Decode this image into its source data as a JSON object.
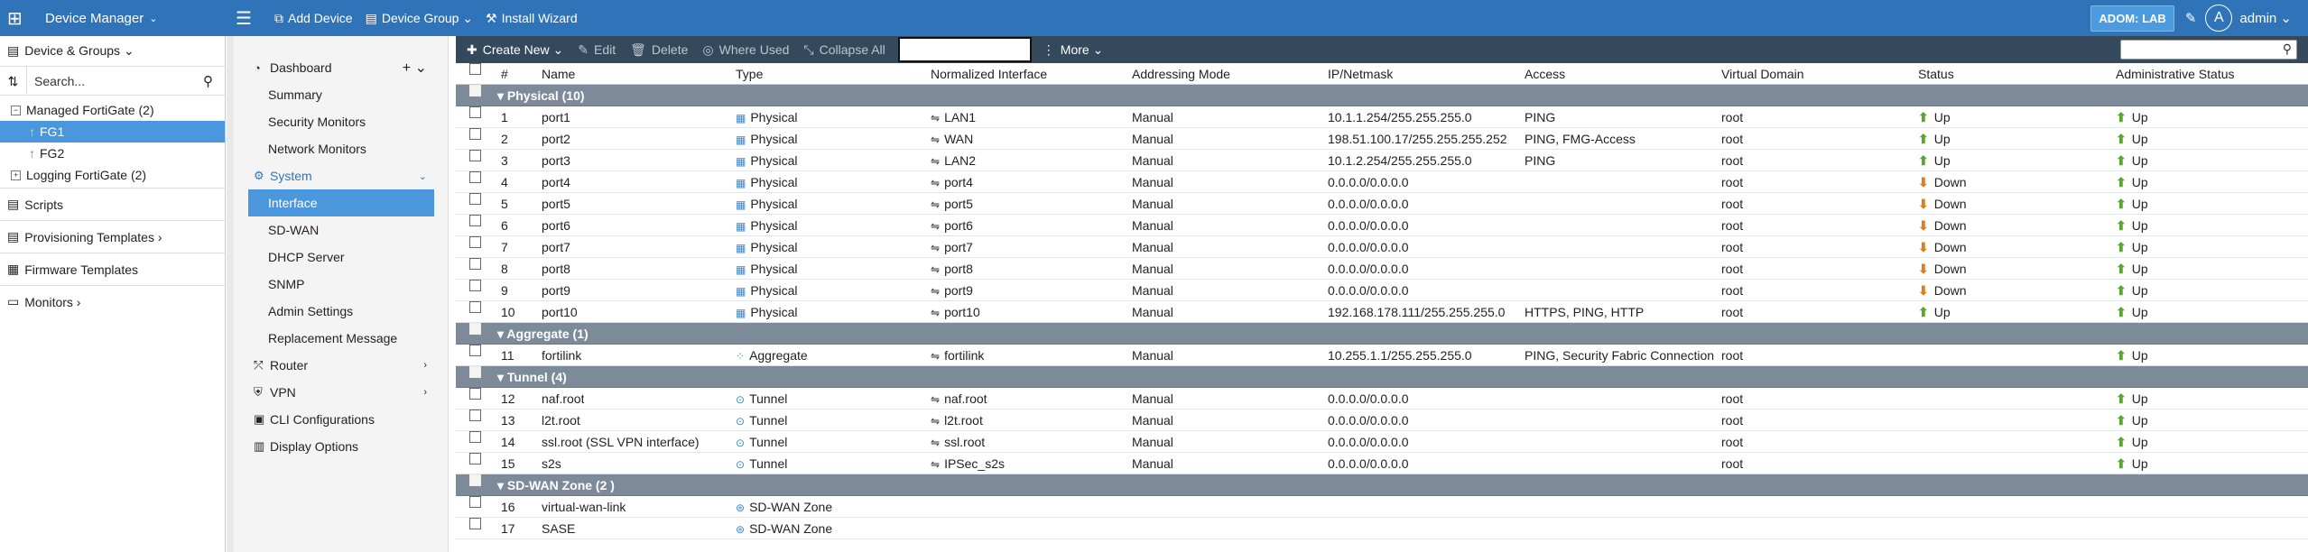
{
  "app": {
    "title": "Device Manager",
    "adom": "ADOM: LAB",
    "user_initial": "A",
    "user": "admin"
  },
  "topbar": {
    "actions": [
      {
        "icon": "add-device-icon",
        "glyph": "⧉",
        "label": "Add Device"
      },
      {
        "icon": "device-group-icon",
        "glyph": "▤",
        "label": "Device Group ⌄"
      },
      {
        "icon": "install-wizard-icon",
        "glyph": "⚒",
        "label": "Install Wizard"
      }
    ]
  },
  "left": {
    "header": "Device & Groups ⌄",
    "search_placeholder": "Search...",
    "tree": [
      {
        "name": "tree-managed",
        "label": "Managed FortiGate (2)",
        "box": "−",
        "type": "group",
        "selected": false
      },
      {
        "name": "tree-fg1",
        "label": "FG1",
        "type": "device",
        "selected": true
      },
      {
        "name": "tree-fg2",
        "label": "FG2",
        "type": "device",
        "selected": false
      },
      {
        "name": "tree-logging",
        "label": "Logging FortiGate (2)",
        "box": "+",
        "type": "group",
        "selected": false
      }
    ],
    "menu": [
      {
        "name": "menu-scripts",
        "icon": "script-icon",
        "glyph": "▤",
        "label": "Scripts"
      },
      {
        "name": "menu-provisioning",
        "icon": "templates-icon",
        "glyph": "▤",
        "label": "Provisioning Templates ›"
      },
      {
        "name": "menu-firmware",
        "icon": "firmware-icon",
        "glyph": "▦",
        "label": "Firmware Templates"
      },
      {
        "name": "menu-monitors",
        "icon": "monitor-icon",
        "glyph": "▭",
        "label": "Monitors ›"
      }
    ]
  },
  "nav": [
    {
      "label": "Dashboard",
      "top": true,
      "glyph": "◔",
      "icon": "dashboard-icon",
      "plus": "+ ⌄"
    },
    {
      "label": "Summary"
    },
    {
      "label": "Security Monitors"
    },
    {
      "label": "Network Monitors"
    },
    {
      "label": "System",
      "top": true,
      "glyph": "⚙",
      "icon": "system-icon",
      "system": true,
      "arrow": "⌄"
    },
    {
      "label": "Interface",
      "selected": true
    },
    {
      "label": "SD-WAN"
    },
    {
      "label": "DHCP Server"
    },
    {
      "label": "SNMP"
    },
    {
      "label": "Admin Settings"
    },
    {
      "label": "Replacement Message"
    },
    {
      "label": "Router",
      "top": true,
      "glyph": "⤱",
      "icon": "router-icon",
      "arrow": "›"
    },
    {
      "label": "VPN",
      "top": true,
      "glyph": "⛨",
      "icon": "vpn-icon",
      "arrow": "›"
    },
    {
      "label": "CLI Configurations",
      "top": true,
      "glyph": "▣",
      "icon": "cli-icon"
    },
    {
      "label": "Display Options",
      "top": true,
      "glyph": "▥",
      "icon": "display-options-icon"
    }
  ],
  "toolbar": {
    "create": "Create New ⌄",
    "edit": "Edit",
    "delete": "Delete",
    "where_used": "Where Used",
    "collapse": "Collapse All",
    "more": "More ⌄"
  },
  "columns": [
    "#",
    "Name",
    "Type",
    "Normalized Interface",
    "Addressing Mode",
    "IP/Netmask",
    "Access",
    "Virtual Domain",
    "Status",
    "Administrative Status"
  ],
  "rows": [
    {
      "group": "Physical (10)"
    },
    {
      "n": "1",
      "name": "port1",
      "type": "Physical",
      "ni": "LAN1",
      "addr": "Manual",
      "ip": "10.1.1.254/255.255.255.0",
      "acc": "PING",
      "vd": "root",
      "st": "Up",
      "adm": "Up"
    },
    {
      "n": "2",
      "name": "port2",
      "type": "Physical",
      "ni": "WAN",
      "addr": "Manual",
      "ip": "198.51.100.17/255.255.255.252",
      "acc": "PING, FMG-Access",
      "vd": "root",
      "st": "Up",
      "adm": "Up"
    },
    {
      "n": "3",
      "name": "port3",
      "type": "Physical",
      "ni": "LAN2",
      "addr": "Manual",
      "ip": "10.1.2.254/255.255.255.0",
      "acc": "PING",
      "vd": "root",
      "st": "Up",
      "adm": "Up"
    },
    {
      "n": "4",
      "name": "port4",
      "type": "Physical",
      "ni": "port4",
      "addr": "Manual",
      "ip": "0.0.0.0/0.0.0.0",
      "acc": "",
      "vd": "root",
      "st": "Down",
      "adm": "Up"
    },
    {
      "n": "5",
      "name": "port5",
      "type": "Physical",
      "ni": "port5",
      "addr": "Manual",
      "ip": "0.0.0.0/0.0.0.0",
      "acc": "",
      "vd": "root",
      "st": "Down",
      "adm": "Up"
    },
    {
      "n": "6",
      "name": "port6",
      "type": "Physical",
      "ni": "port6",
      "addr": "Manual",
      "ip": "0.0.0.0/0.0.0.0",
      "acc": "",
      "vd": "root",
      "st": "Down",
      "adm": "Up"
    },
    {
      "n": "7",
      "name": "port7",
      "type": "Physical",
      "ni": "port7",
      "addr": "Manual",
      "ip": "0.0.0.0/0.0.0.0",
      "acc": "",
      "vd": "root",
      "st": "Down",
      "adm": "Up"
    },
    {
      "n": "8",
      "name": "port8",
      "type": "Physical",
      "ni": "port8",
      "addr": "Manual",
      "ip": "0.0.0.0/0.0.0.0",
      "acc": "",
      "vd": "root",
      "st": "Down",
      "adm": "Up"
    },
    {
      "n": "9",
      "name": "port9",
      "type": "Physical",
      "ni": "port9",
      "addr": "Manual",
      "ip": "0.0.0.0/0.0.0.0",
      "acc": "",
      "vd": "root",
      "st": "Down",
      "adm": "Up"
    },
    {
      "n": "10",
      "name": "port10",
      "type": "Physical",
      "ni": "port10",
      "addr": "Manual",
      "ip": "192.168.178.111/255.255.255.0",
      "acc": "HTTPS, PING, HTTP",
      "vd": "root",
      "st": "Up",
      "adm": "Up"
    },
    {
      "group": "Aggregate (1)"
    },
    {
      "n": "11",
      "name": "fortilink",
      "type": "Aggregate",
      "ni": "fortilink",
      "addr": "Manual",
      "ip": "10.255.1.1/255.255.255.0",
      "acc": "PING, Security Fabric Connection",
      "vd": "root",
      "st": "",
      "adm": "Up"
    },
    {
      "group": "Tunnel (4)"
    },
    {
      "n": "12",
      "name": "naf.root",
      "type": "Tunnel",
      "ni": "naf.root",
      "addr": "Manual",
      "ip": "0.0.0.0/0.0.0.0",
      "acc": "",
      "vd": "root",
      "st": "",
      "adm": "Up"
    },
    {
      "n": "13",
      "name": "l2t.root",
      "type": "Tunnel",
      "ni": "l2t.root",
      "addr": "Manual",
      "ip": "0.0.0.0/0.0.0.0",
      "acc": "",
      "vd": "root",
      "st": "",
      "adm": "Up"
    },
    {
      "n": "14",
      "name": "ssl.root (SSL VPN interface)",
      "type": "Tunnel",
      "ni": "ssl.root",
      "addr": "Manual",
      "ip": "0.0.0.0/0.0.0.0",
      "acc": "",
      "vd": "root",
      "st": "",
      "adm": "Up"
    },
    {
      "n": "15",
      "name": "s2s",
      "type": "Tunnel",
      "ni": "IPSec_s2s",
      "addr": "Manual",
      "ip": "0.0.0.0/0.0.0.0",
      "acc": "",
      "vd": "root",
      "st": "",
      "adm": "Up"
    },
    {
      "group": "SD-WAN Zone (2 )"
    },
    {
      "n": "16",
      "name": "virtual-wan-link",
      "type": "SD-WAN Zone",
      "ni": "",
      "addr": "",
      "ip": "",
      "acc": "",
      "vd": "",
      "st": "",
      "adm": ""
    },
    {
      "n": "17",
      "name": "SASE",
      "type": "SD-WAN Zone",
      "ni": "",
      "addr": "",
      "ip": "",
      "acc": "",
      "vd": "",
      "st": "",
      "adm": ""
    }
  ]
}
